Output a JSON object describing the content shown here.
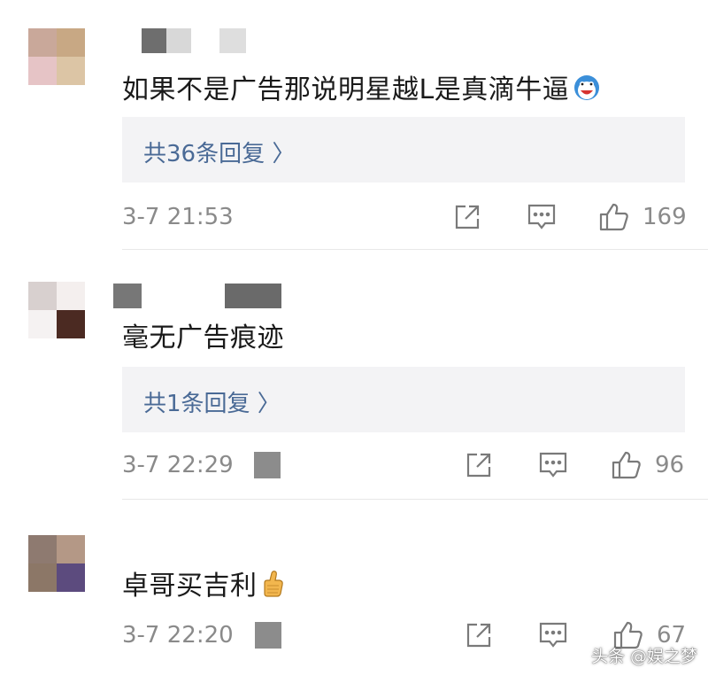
{
  "comments": [
    {
      "text": "如果不是广告那说明星越L是真滴牛逼",
      "reply_label": "共36条回复 〉",
      "timestamp": "3-7 21:53",
      "likes": "169",
      "emoji_icon": "laughing-face-icon"
    },
    {
      "text": "毫无广告痕迹",
      "reply_label": "共1条回复 〉",
      "timestamp": "3-7 22:29",
      "likes": "96"
    },
    {
      "text": "卓哥买吉利",
      "timestamp": "3-7 22:20",
      "likes": "67",
      "emoji_icon": "thumbs-up-emoji-icon"
    }
  ],
  "watermark": "头条 @娱之梦",
  "colors": {
    "reply_link": "#4a6a96",
    "meta_text": "#8a8a8a",
    "reply_bg": "#f3f3f5"
  }
}
